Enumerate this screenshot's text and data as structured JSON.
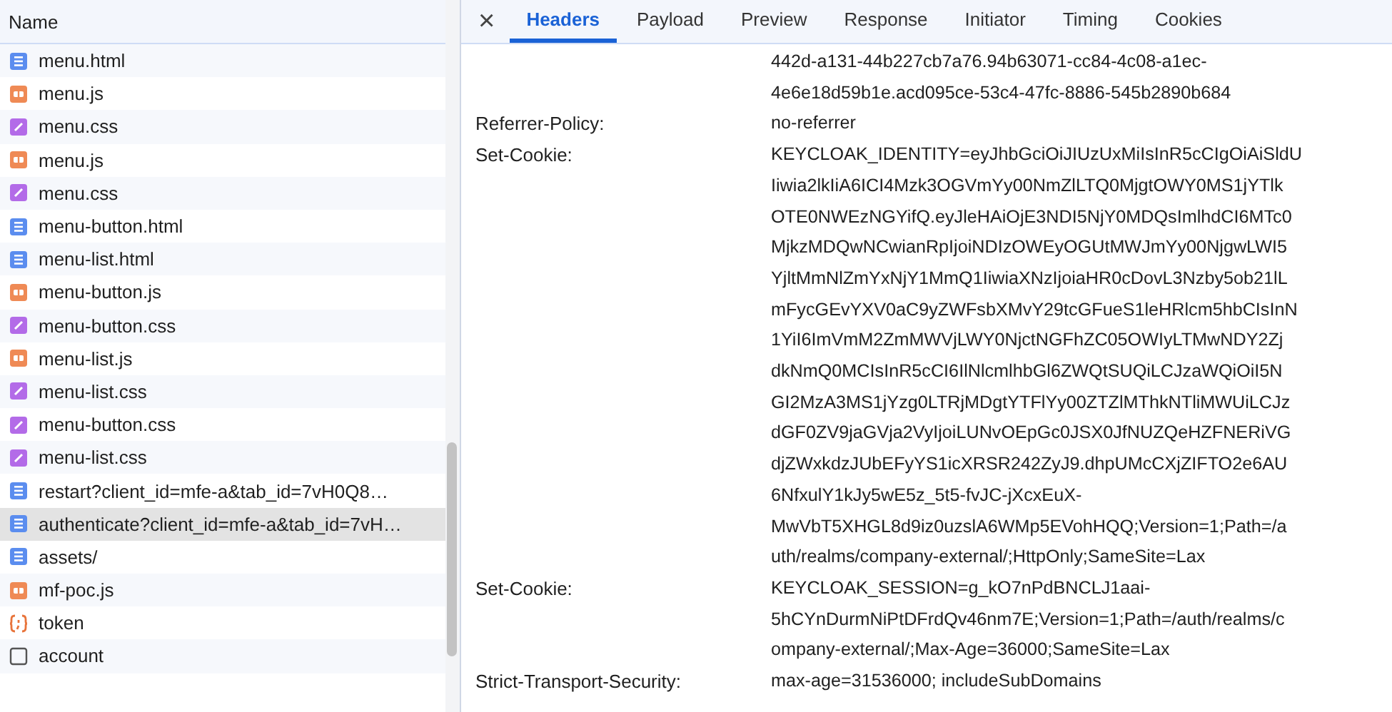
{
  "requests": {
    "column": "Name",
    "rows": [
      {
        "name": "menu.html",
        "kind": "document",
        "selected": false
      },
      {
        "name": "menu.js",
        "kind": "script",
        "selected": false
      },
      {
        "name": "menu.css",
        "kind": "stylesheet",
        "selected": false
      },
      {
        "name": "menu.js",
        "kind": "script",
        "selected": false
      },
      {
        "name": "menu.css",
        "kind": "stylesheet",
        "selected": false
      },
      {
        "name": "menu-button.html",
        "kind": "document",
        "selected": false
      },
      {
        "name": "menu-list.html",
        "kind": "document",
        "selected": false
      },
      {
        "name": "menu-button.js",
        "kind": "script",
        "selected": false
      },
      {
        "name": "menu-button.css",
        "kind": "stylesheet",
        "selected": false
      },
      {
        "name": "menu-list.js",
        "kind": "script",
        "selected": false
      },
      {
        "name": "menu-list.css",
        "kind": "stylesheet",
        "selected": false
      },
      {
        "name": "menu-button.css",
        "kind": "stylesheet",
        "selected": false
      },
      {
        "name": "menu-list.css",
        "kind": "stylesheet",
        "selected": false
      },
      {
        "name": "restart?client_id=mfe-a&tab_id=7vH0Q8…",
        "kind": "document",
        "selected": false
      },
      {
        "name": "authenticate?client_id=mfe-a&tab_id=7vH…",
        "kind": "document",
        "selected": true
      },
      {
        "name": "assets/",
        "kind": "document",
        "selected": false
      },
      {
        "name": "mf-poc.js",
        "kind": "script",
        "selected": false
      },
      {
        "name": "token",
        "kind": "fetch",
        "selected": false
      },
      {
        "name": "account",
        "kind": "other",
        "selected": false
      }
    ]
  },
  "details": {
    "close": "×",
    "tabs": [
      {
        "label": "Headers",
        "selected": true
      },
      {
        "label": "Payload",
        "selected": false
      },
      {
        "label": "Preview",
        "selected": false
      },
      {
        "label": "Response",
        "selected": false
      },
      {
        "label": "Initiator",
        "selected": false
      },
      {
        "label": "Timing",
        "selected": false
      },
      {
        "label": "Cookies",
        "selected": false
      }
    ],
    "headers": [
      {
        "lines": [
          "442d-a131-44b227cb7a76.94b63071-cc84-4c08-a1ec-",
          "4e6e18d59b1e.acd095ce-53c4-47fc-8886-545b2890b684"
        ]
      },
      {
        "name": "Referrer-Policy:",
        "lines": [
          "no-referrer"
        ]
      },
      {
        "name": "Set-Cookie:",
        "lines": [
          "KEYCLOAK_IDENTITY=eyJhbGciOiJIUzUxMiIsInR5cCIgOiAiSldU",
          "Iiwia2lkIiA6ICI4Mzk3OGVmYy00NmZlLTQ0MjgtOWY0MS1jYTlk",
          "OTE0NWEzNGYifQ.eyJleHAiOjE3NDI5NjY0MDQsImlhdCI6MTc0",
          "MjkzMDQwNCwianRpIjoiNDIzOWEyOGUtMWJmYy00NjgwLWI5",
          "YjltMmNlZmYxNjY1MmQ1IiwiaXNzIjoiaHR0cDovL3Nzby5ob21lL",
          "mFycGEvYXV0aC9yZWFsbXMvY29tcGFueS1leHRlcm5hbCIsInN",
          "1YiI6ImVmM2ZmMWVjLWY0NjctNGFhZC05OWIyLTMwNDY2Zj",
          "dkNmQ0MCIsInR5cCI6IlNlcmlhbGl6ZWQtSUQiLCJzaWQiOiI5N",
          "GI2MzA3MS1jYzg0LTRjMDgtYTFlYy00ZTZlMThkNTliMWUiLCJz",
          "dGF0ZV9jaGVja2VyIjoiLUNvOEpGc0JSX0JfNUZQeHZFNERiVG",
          "djZWxkdzJUbEFyYS1icXRSR242ZyJ9.dhpUMcCXjZIFTO2e6AU",
          "6NfxulY1kJy5wE5z_5t5-fvJC-jXcxEuX-",
          "MwVbT5XHGL8d9iz0uzslA6WMp5EVohHQQ;Version=1;Path=/a",
          "uth/realms/company-external/;HttpOnly;SameSite=Lax"
        ]
      },
      {
        "name": "Set-Cookie:",
        "lines": [
          "KEYCLOAK_SESSION=g_kO7nPdBNCLJ1aai-",
          "5hCYnDurmNiPtDFrdQv46nm7E;Version=1;Path=/auth/realms/c",
          "ompany-external/;Max-Age=36000;SameSite=Lax"
        ]
      },
      {
        "name": "Strict-Transport-Security:",
        "lines": [
          "max-age=31536000; includeSubDomains"
        ]
      }
    ]
  }
}
